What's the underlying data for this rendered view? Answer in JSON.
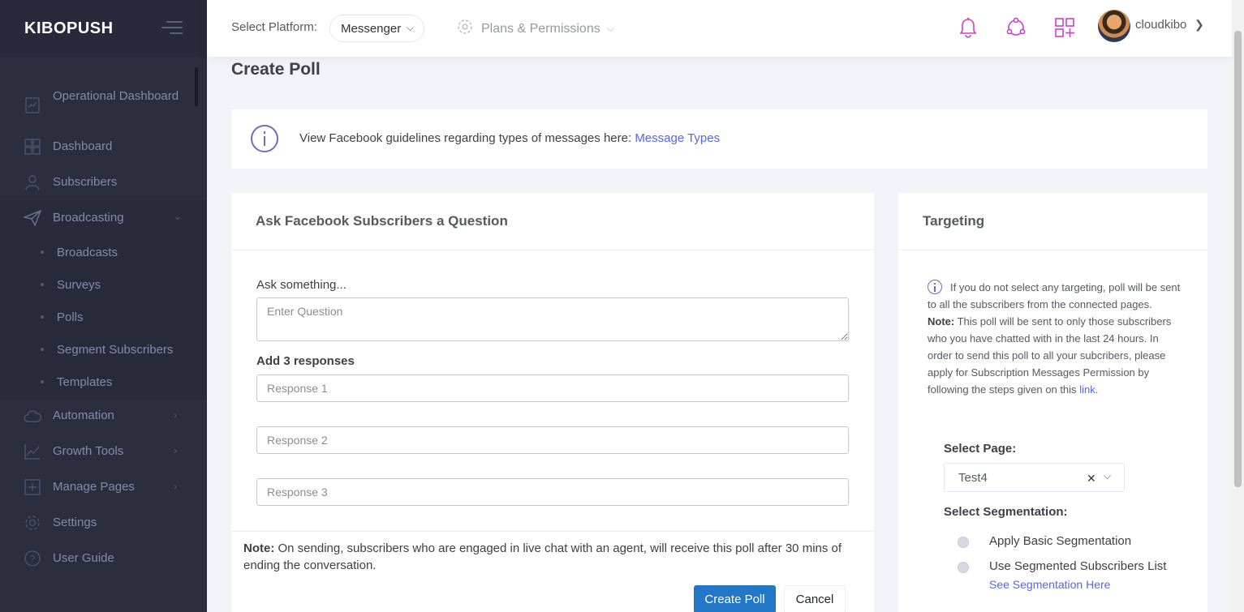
{
  "brand": {
    "name": "KIBOPUSH"
  },
  "sidebar": {
    "items": [
      {
        "label": "Operational Dashboard",
        "icon": "chart-doc-icon"
      },
      {
        "label": "Dashboard",
        "icon": "grid-icon"
      },
      {
        "label": "Subscribers",
        "icon": "user-icon"
      },
      {
        "label": "Broadcasting",
        "icon": "paper-plane-icon"
      },
      {
        "label": "Automation",
        "icon": "cloud-icon"
      },
      {
        "label": "Growth Tools",
        "icon": "line-chart-icon"
      },
      {
        "label": "Manage Pages",
        "icon": "add-page-icon"
      },
      {
        "label": "Settings",
        "icon": "gear-icon"
      },
      {
        "label": "User Guide",
        "icon": "question-icon"
      }
    ],
    "broadcasting_sub": [
      "Broadcasts",
      "Surveys",
      "Polls",
      "Segment Subscribers",
      "Templates"
    ]
  },
  "header": {
    "platform_label": "Select Platform:",
    "platform_value": "Messenger",
    "plans_label": "Plans & Permissions",
    "username": "cloudkibo"
  },
  "page": {
    "title": "Create Poll"
  },
  "alert": {
    "text": "View Facebook guidelines regarding types of messages here:",
    "link": "Message Types"
  },
  "poll_form": {
    "title": "Ask Facebook Subscribers a Question",
    "ask_label": "Ask something...",
    "question_placeholder": "Enter Question",
    "responses_label": "Add 3 responses",
    "responses": [
      {
        "placeholder": "Response 1"
      },
      {
        "placeholder": "Response 2"
      },
      {
        "placeholder": "Response 3"
      }
    ],
    "note_bold": "Note:",
    "note_text": "On sending, subscribers who are engaged in live chat with an agent, will receive this poll after 30 mins of ending the conversation.",
    "create_button": "Create Poll",
    "cancel_button": "Cancel"
  },
  "targeting": {
    "title": "Targeting",
    "info_text": "If you do not select any targeting, poll will be sent to all the subscribers from the connected pages.",
    "note_bold": "Note:",
    "note_text": "This poll will be sent to only those subscribers who you have chatted with in the last 24 hours. In order to send this poll to all your subcribers, please apply for Subscription Messages Permission by following the steps given on this",
    "note_link": "link",
    "select_page_label": "Select Page:",
    "page_value": "Test4",
    "select_segmentation_label": "Select Segmentation:",
    "options": [
      "Apply Basic Segmentation",
      "Use Segmented Subscribers List"
    ],
    "segmentation_link": "See Segmentation Here"
  },
  "colors": {
    "sidebar_bg": "#2c2e3e",
    "brand_bg": "#282a3c",
    "primary_button": "#2277c6",
    "link": "#5867dd",
    "header_icon": "#c843c5"
  }
}
